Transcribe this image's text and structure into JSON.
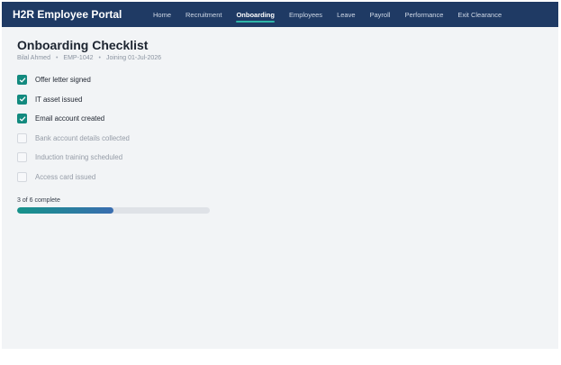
{
  "brand": {
    "name": "H2R Employee Portal"
  },
  "nav": {
    "items": [
      {
        "label": "Home",
        "active": false
      },
      {
        "label": "Recruitment",
        "active": false
      },
      {
        "label": "Onboarding",
        "active": true
      },
      {
        "label": "Employees",
        "active": false
      },
      {
        "label": "Leave",
        "active": false
      },
      {
        "label": "Payroll",
        "active": false
      },
      {
        "label": "Performance",
        "active": false
      },
      {
        "label": "Exit Clearance",
        "active": false
      }
    ]
  },
  "page": {
    "title": "Onboarding Checklist",
    "employee_name": "Bilal Ahmed",
    "employee_id": "EMP-1042",
    "joining": "Joining 01-Jul-2026",
    "separator": "•"
  },
  "checklist": {
    "items": [
      {
        "label": "Offer letter signed",
        "checked": true
      },
      {
        "label": "IT asset issued",
        "checked": true
      },
      {
        "label": "Email account created",
        "checked": true
      },
      {
        "label": "Bank account details collected",
        "checked": false
      },
      {
        "label": "Induction training scheduled",
        "checked": false
      },
      {
        "label": "Access card issued",
        "checked": false
      }
    ]
  },
  "progress": {
    "text": "3 of 6 complete",
    "fraction": 0.5
  },
  "colors": {
    "topbar": "#1f3a64",
    "accent": "#138a7f",
    "progress_start": "#16938a",
    "progress_end": "#3a6db0"
  },
  "icons": {
    "check": "check-icon"
  }
}
